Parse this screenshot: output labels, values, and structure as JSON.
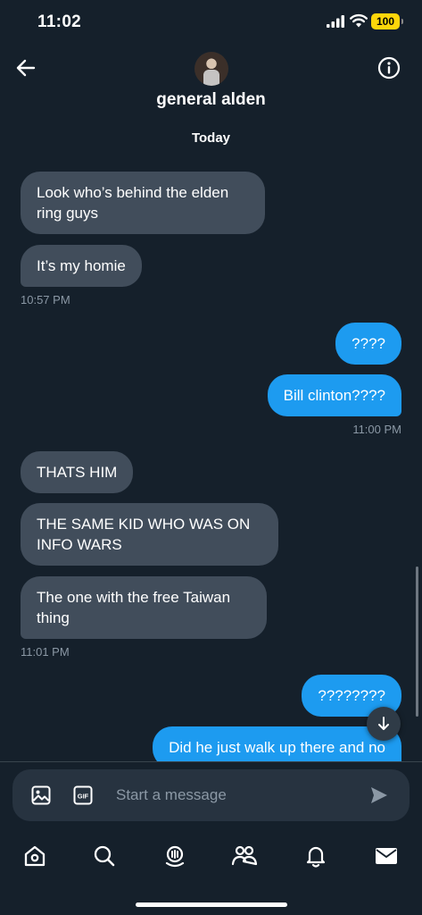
{
  "status_bar": {
    "time": "11:02",
    "battery": "100"
  },
  "header": {
    "contact_name": "general alden",
    "back_icon": "arrow-left-icon",
    "info_icon": "info-icon"
  },
  "conversation": {
    "day_label": "Today",
    "groups": [
      {
        "messages": [
          "Look who’s behind the elden ring guys",
          "It’s my homie"
        ],
        "time": "10:57 PM"
      },
      {
        "messages": [
          "????",
          "Bill clinton????"
        ],
        "time": "11:00 PM"
      },
      {
        "messages": [
          "THATS HIM",
          "THE SAME KID WHO WAS ON INFO WARS",
          "The one with the free Taiwan thing"
        ],
        "time": "11:01 PM"
      },
      {
        "messages": [
          "????????",
          "Did he just walk up there and no"
        ]
      }
    ]
  },
  "composer": {
    "placeholder": "Start a message",
    "media_icon": "image-icon",
    "gif_label": "GIF",
    "send_icon": "send-icon"
  },
  "tabbar": {
    "items": [
      "home-icon",
      "search-icon",
      "spaces-icon",
      "communities-icon",
      "notifications-icon",
      "messages-icon"
    ]
  },
  "colors": {
    "background": "#15202b",
    "incoming_bubble": "#414d5b",
    "outgoing_bubble": "#1d9bf0",
    "timestamp": "#8b98a5",
    "battery": "#ffd60a"
  }
}
